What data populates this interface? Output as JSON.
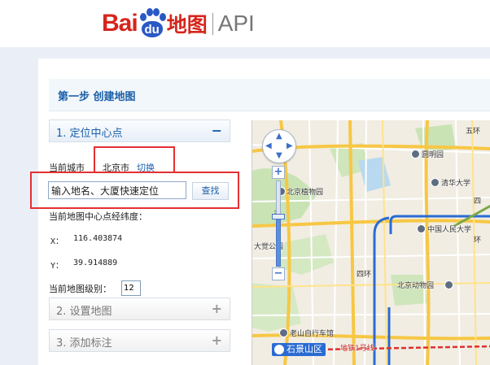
{
  "logo": {
    "brand_bai": "Bai",
    "brand_du": "du",
    "brand_ditu": "地图",
    "product": "API"
  },
  "step": {
    "title": "第一步 创建地图"
  },
  "sections": [
    {
      "label": "1. 定位中心点",
      "icon": "−",
      "expanded": true
    },
    {
      "label": "2. 设置地图",
      "icon": "+",
      "expanded": false
    },
    {
      "label": "3. 添加标注",
      "icon": "+",
      "expanded": false
    }
  ],
  "locate": {
    "city_label": "当前城市",
    "city_name": "北京市",
    "switch_label": "切换",
    "search_value": "输入地名、大厦快速定位",
    "search_button": "查找",
    "center_label": "当前地图中心点经纬度：",
    "x_label": "X：",
    "x_value": "116.403874",
    "y_label": "Y：",
    "y_value": "39.914889",
    "zoom_label": "当前地图级别：",
    "zoom_value": "12"
  },
  "map": {
    "labels": {
      "yuanmingyuan": "圆明园",
      "qinghua": "清华大学",
      "zhiwuyuan": "北京植物园",
      "renmin": "中国人民大学",
      "dajuegong": "大觉公园",
      "dongwuyuan": "北京动物园",
      "laoshan": "老山自行车馆",
      "shijingshan": "石景山区",
      "metro_line": "地铁1号线",
      "ring_4": "四环",
      "ring_5": "五环",
      "ring_4b": "四",
      "ring_huan": "环",
      "ring_wu": "五"
    },
    "accent_color": "#2a6bd3"
  }
}
